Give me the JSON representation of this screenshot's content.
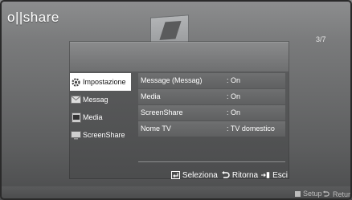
{
  "app": {
    "logo": "o||share",
    "page_counter": "3/7"
  },
  "tabs": [
    {
      "label": "Impostazione",
      "icon": "gear-icon",
      "active": true
    },
    {
      "label": "Messag",
      "icon": "envelope-icon",
      "active": false
    },
    {
      "label": "Media",
      "icon": "media-file-icon",
      "active": false
    },
    {
      "label": "ScreenShare",
      "icon": "screenshare-icon",
      "active": false
    }
  ],
  "settings": [
    {
      "name": "Message (Messag)",
      "value": ": On"
    },
    {
      "name": "Media",
      "value": ": On"
    },
    {
      "name": "ScreenShare",
      "value": ": On"
    },
    {
      "name": "Nome TV",
      "value": ": TV domestico"
    }
  ],
  "footer": {
    "select_label": "Seleziona",
    "return_label": "Ritorna",
    "exit_label": "Esci"
  },
  "bottom_bar": {
    "setup_label": "Setup",
    "return_label": "Return"
  },
  "colors": {
    "background": "#7a7b7c",
    "panel": "#5a5b5c",
    "active_tab": "#ffffff",
    "text": "#ffffff"
  }
}
